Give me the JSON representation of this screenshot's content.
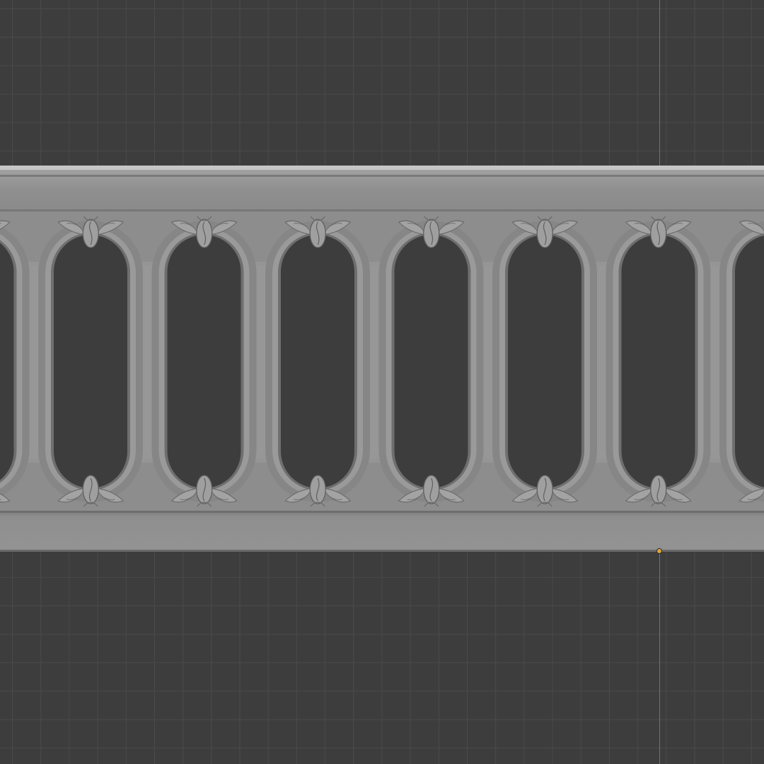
{
  "viewport": {
    "view": "orthographic-front",
    "background_color": "#3d3d3d",
    "grid_color": "#4a4a4a",
    "axis_color": "#3f7fb8",
    "origin_color": "#e0a43a"
  },
  "model": {
    "type": "carved-balustrade-frieze",
    "material_color": "#8e8e8e",
    "oval_openings_visible": 7,
    "ornament_motif": "acanthus-leaf-cartouche",
    "ornament_rows": [
      "top",
      "bottom"
    ]
  },
  "icons": {
    "origin": "origin-dot-icon",
    "ornament": "leaf-ornament-icon"
  }
}
